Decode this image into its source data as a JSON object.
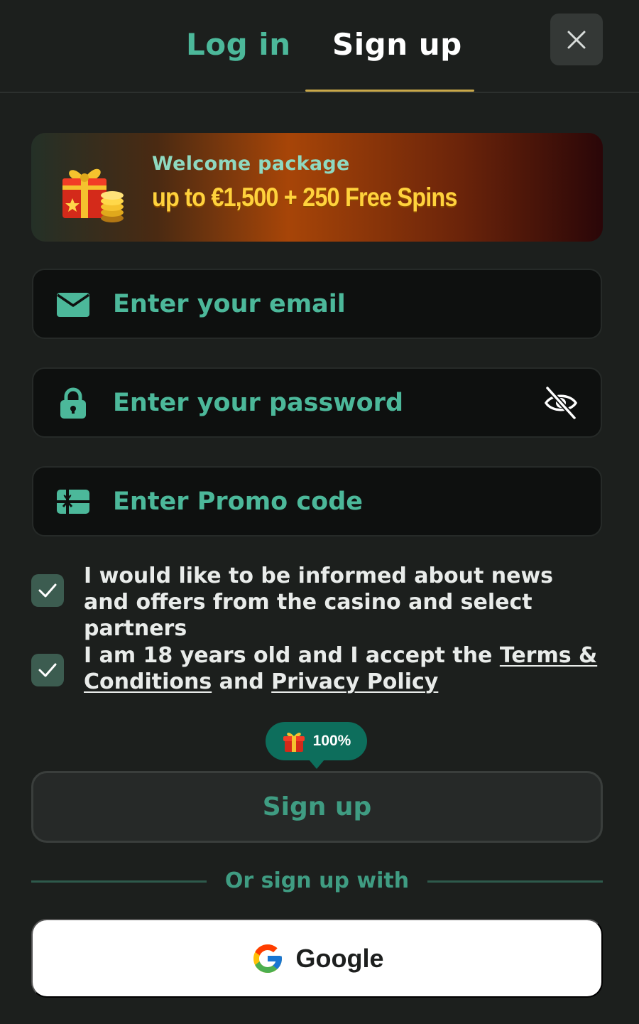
{
  "tabs": [
    {
      "label": "Log in",
      "active": false
    },
    {
      "label": "Sign up",
      "active": true
    }
  ],
  "banner": {
    "label": "Welcome package",
    "offer": "up to €1,500 + 250 Free Spins"
  },
  "form": {
    "email_placeholder": "Enter your email",
    "password_placeholder": "Enter your password",
    "promo_placeholder": "Enter Promo code"
  },
  "consents": {
    "news": {
      "checked": true,
      "text": "I would like to be informed about news and offers from the casino and select partners"
    },
    "terms": {
      "checked": true,
      "text_before": "I am 18 years old and I accept the ",
      "terms_link": "Terms & Conditions",
      "text_middle": " and ",
      "privacy_link": "Privacy Policy"
    }
  },
  "bonus_badge": {
    "text": "100%"
  },
  "signup_button": {
    "label": "Sign up"
  },
  "divider": {
    "text": "Or sign up with"
  },
  "google_button": {
    "label": "Google"
  },
  "colors": {
    "background": "#1c1f1d",
    "accent": "#4cb89a",
    "tab_underline": "#c9a84a",
    "offer_gold": "#ffd23c",
    "badge": "#0d6e5c"
  }
}
